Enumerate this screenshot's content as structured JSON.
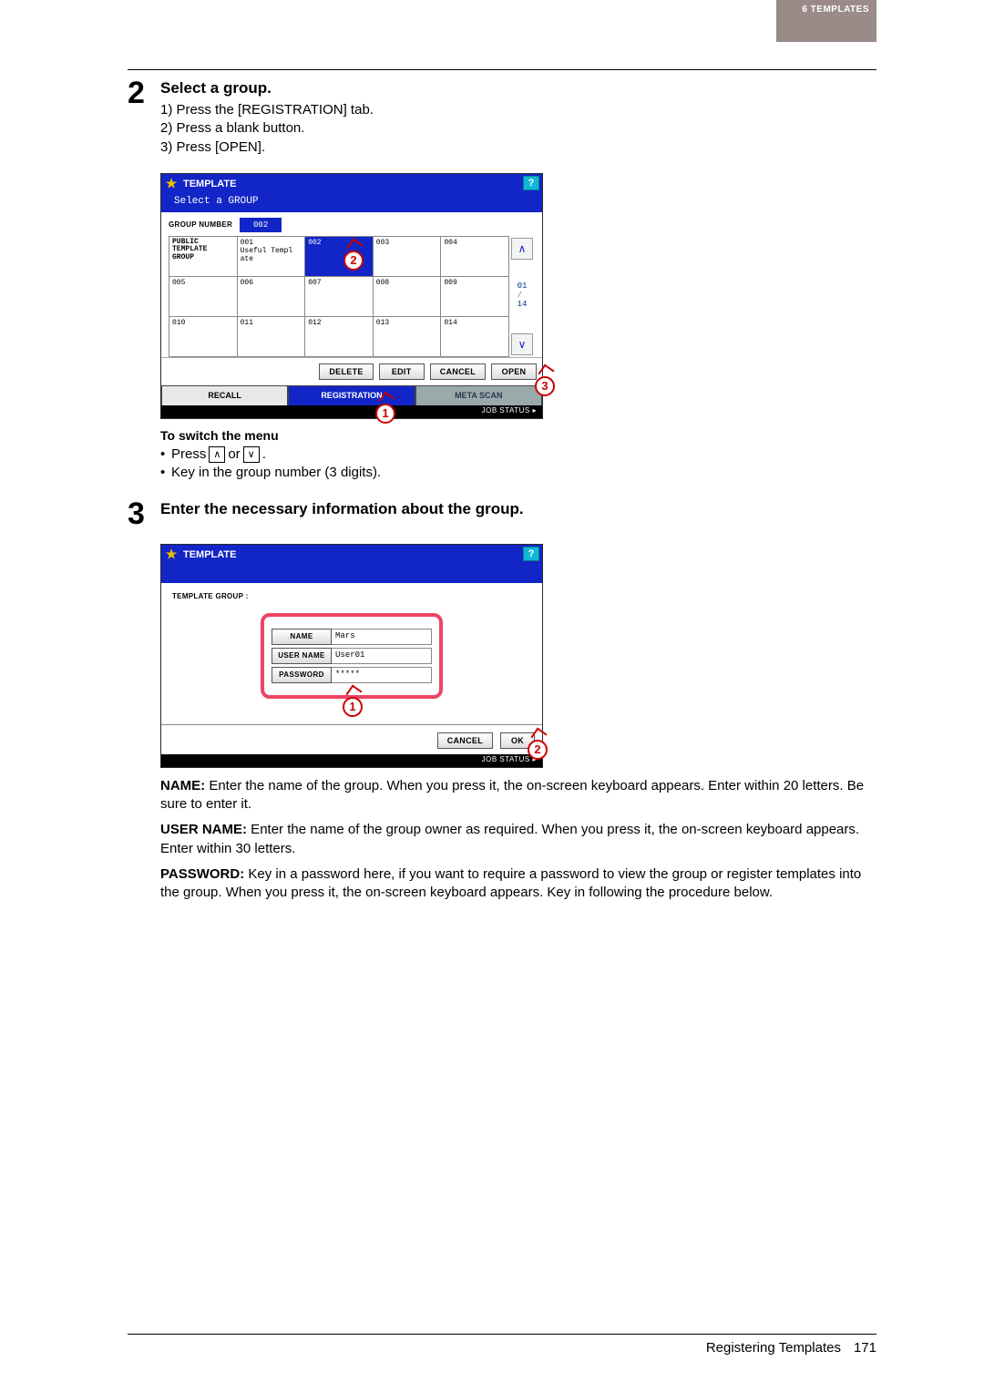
{
  "header_band": "6 TEMPLATES",
  "chapter_tab": "6",
  "step2": {
    "num": "2",
    "title": "Select a group.",
    "items": [
      "1)  Press the [REGISTRATION] tab.",
      "2)  Press a blank button.",
      "3)  Press [OPEN]."
    ]
  },
  "panel1": {
    "title": "TEMPLATE",
    "help": "?",
    "subtitle": "Select a GROUP",
    "group_number_label": "GROUP NUMBER",
    "group_number_value": "002",
    "side_page": "01\n⁄\n14",
    "rows": [
      [
        {
          "text": "PUBLIC\nTEMPLATE\nGROUP",
          "ptg": true
        },
        {
          "text": "001\nUseful Templ\nate"
        },
        {
          "text": "002",
          "sel": true
        },
        {
          "text": "003"
        },
        {
          "text": "004"
        }
      ],
      [
        {
          "text": "005"
        },
        {
          "text": "006"
        },
        {
          "text": "007"
        },
        {
          "text": "008"
        },
        {
          "text": "009"
        }
      ],
      [
        {
          "text": "010"
        },
        {
          "text": "011"
        },
        {
          "text": "012"
        },
        {
          "text": "013"
        },
        {
          "text": "014"
        }
      ]
    ],
    "btns": {
      "delete": "DELETE",
      "edit": "EDIT",
      "cancel": "CANCEL",
      "open": "OPEN"
    },
    "tabs": {
      "recall": "RECALL",
      "reg": "REGISTRATION",
      "meta": "META SCAN"
    },
    "job_status": "JOB STATUS   ▸",
    "callouts": {
      "c1": "1",
      "c2": "2",
      "c3": "3"
    }
  },
  "switch_menu": {
    "heading": "To switch the menu",
    "press": "Press",
    "or": "or",
    "period": ".",
    "line2": "Key in the group number (3 digits)."
  },
  "step3": {
    "num": "3",
    "title": "Enter the necessary information about the group."
  },
  "panel2": {
    "title": "TEMPLATE",
    "help": "?",
    "group_label": "TEMPLATE GROUP  :",
    "fields": {
      "name_label": "NAME",
      "name_value": "Mars",
      "user_label": "USER NAME",
      "user_value": "User01",
      "pass_label": "PASSWORD",
      "pass_value": "*****"
    },
    "btns": {
      "cancel": "CANCEL",
      "ok": "OK"
    },
    "job_status": "JOB STATUS   ▸",
    "callouts": {
      "c1": "1",
      "c2": "2"
    }
  },
  "descriptions": {
    "name": {
      "label": "NAME:",
      "text": " Enter the name of the group. When you press it, the on-screen keyboard appears. Enter within 20 letters. Be sure to enter it."
    },
    "username": {
      "label": "USER NAME:",
      "text": " Enter the name of the group owner as required. When you press it, the on-screen keyboard appears. Enter within 30 letters."
    },
    "password": {
      "label": "PASSWORD:",
      "text": " Key in a password here, if you want to require a password to view the group or register templates into the group. When you press it, the on-screen keyboard appears. Key in following the procedure below."
    }
  },
  "footer": {
    "title": "Registering Templates",
    "page": "171"
  }
}
